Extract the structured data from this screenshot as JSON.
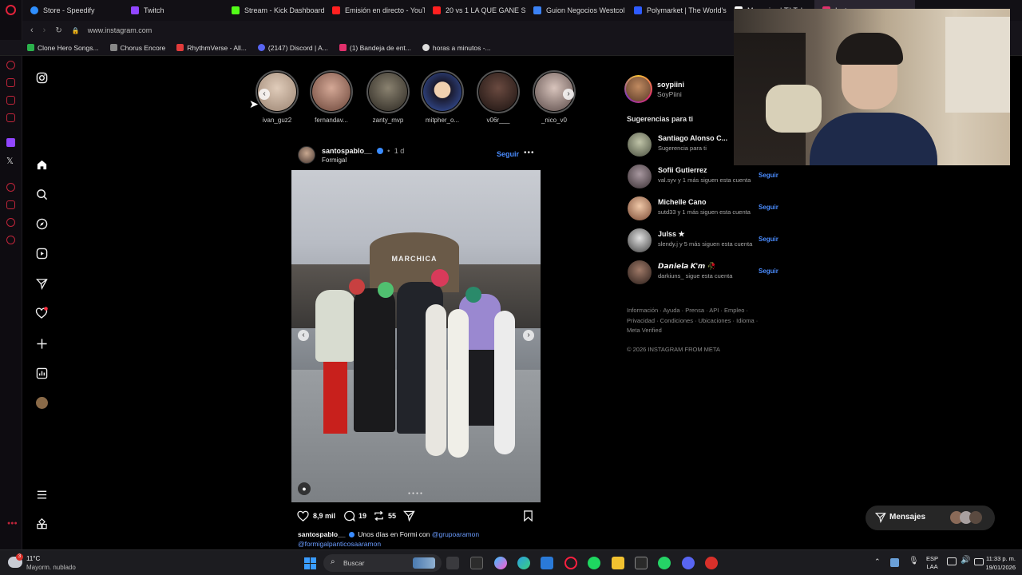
{
  "browser": {
    "tabs": [
      {
        "label": "Store - Speedify",
        "color": "#2f8fff"
      },
      {
        "label": "Twitch",
        "color": "#9146ff"
      },
      {
        "label": "Stream - Kick Dashboard",
        "color": "#53fc18"
      },
      {
        "label": "Emisión en directo - YouT",
        "color": "#ff2020"
      },
      {
        "label": "20 vs 1 LA QUE GANE SE",
        "color": "#ff2020"
      },
      {
        "label": "Guion Negocios Westcol",
        "color": "#3b82f6"
      },
      {
        "label": "Polymarket | The World's",
        "color": "#2e5bff"
      },
      {
        "label": "Mensajes | TikTok",
        "color": "#ffffff"
      },
      {
        "label": "Instagram",
        "color": "#e1306c"
      }
    ],
    "url": "www.instagram.com",
    "bookmarks": [
      {
        "label": "Clone Hero Songs...",
        "color": "#2bb24c"
      },
      {
        "label": "Chorus Encore",
        "color": "#888888"
      },
      {
        "label": "RhythmVerse - All...",
        "color": "#e23b3b"
      },
      {
        "label": "(2147) Discord | A...",
        "color": "#5865f2"
      },
      {
        "label": "(1) Bandeja de ent...",
        "color": "#e1306c"
      },
      {
        "label": "horas a minutos -...",
        "color": "#dddddd"
      }
    ]
  },
  "stories": [
    {
      "name": "ivan_guz2",
      "color": "#c9b6a4"
    },
    {
      "name": "fernandav...",
      "color": "#a07766"
    },
    {
      "name": "zanty_mvp",
      "color": "#4a4438"
    },
    {
      "name": "mitpher_o...",
      "color": "#1f2a55"
    },
    {
      "name": "v06r___",
      "color": "#3a2a26"
    },
    {
      "name": "_nico_v0",
      "color": "#8a7a78"
    }
  ],
  "post": {
    "username": "santospablo__",
    "time": "1 d",
    "location": "Formigal",
    "follow_label": "Seguir",
    "likes": "8,9 mil",
    "comments": "19",
    "reposts": "55",
    "caption_user": "santospablo__",
    "caption_text": "Unos días en Formi con",
    "mention1": "@grupoaramon",
    "mention2": "@formigalpanticosaaramon",
    "image_sign": "MARCHICA"
  },
  "profile": {
    "username": "soypiini",
    "fullname": "SoyPiini"
  },
  "suggestions_title": "Sugerencias para ti",
  "suggestions": [
    {
      "name": "Santiago Alonso C...",
      "sub": "Sugerencia para ti",
      "follow": "",
      "color": "#8c8f7a"
    },
    {
      "name": "Sofii Gutierrez",
      "sub": "val.syv y 1 más siguen esta cuenta",
      "follow": "Seguir",
      "color": "#7a6b6e"
    },
    {
      "name": "Michelle Cano",
      "sub": "sutd33 y 1 más siguen esta cuenta",
      "follow": "Seguir",
      "color": "#c89a80"
    },
    {
      "name": "Julss ★",
      "sub": "slendy.j y 5 más siguen esta cuenta",
      "follow": "Seguir",
      "color": "#9a9a9a"
    },
    {
      "name": "𝘿𝙖𝙣𝙞𝙚𝙡𝙖 𝙆'𝙢 🥀",
      "sub": "darkiuns_ sigue esta cuenta",
      "follow": "Seguir",
      "color": "#6b5048"
    }
  ],
  "footer_links_1": "Información · Ayuda · Prensa · API · Empleo ·",
  "footer_links_2": "Privacidad · Condiciones · Ubicaciones · Idioma ·",
  "footer_links_3": "Meta Verified",
  "copyright": "© 2026 INSTAGRAM FROM META",
  "messages_label": "Mensajes",
  "taskbar": {
    "weather_temp": "11°C",
    "weather_desc": "Mayorm. nublado",
    "search_placeholder": "Buscar",
    "lang1": "ESP",
    "lang2": "LAA",
    "time": "11:33 p. m.",
    "date": "19/01/2026",
    "notif_count": "3"
  }
}
